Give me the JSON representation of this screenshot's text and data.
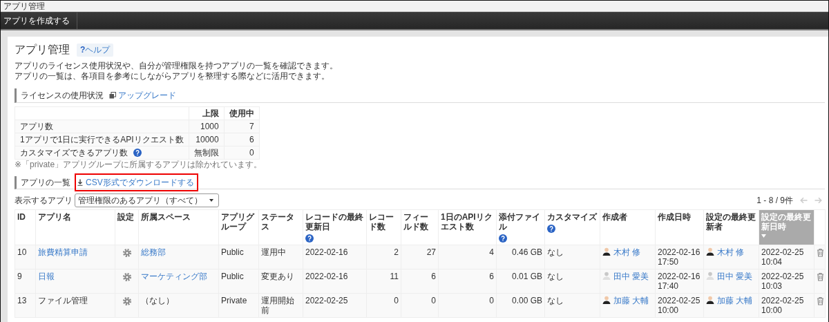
{
  "window": {
    "title": "アプリ管理"
  },
  "toolbar": {
    "buttons": [
      "アプリを作成する"
    ]
  },
  "page": {
    "title": "アプリ管理",
    "help_link": "**?**ヘルプ",
    "description": [
      "アプリのライセンス使用状況や、自分が管理権限を持つアプリの一覧を確認できます。",
      "アプリの一覧は、各項目を参考にしながらアプリを整理する際などに活用できます。"
    ]
  },
  "license": {
    "heading": "ライセンスの使用状況",
    "upgrade_link": "アップグレード",
    "columns": [
      "上限",
      "使用中"
    ],
    "rows": [
      {
        "label": "アプリ数",
        "help": false,
        "limit": "1000",
        "used": "7"
      },
      {
        "label": "1アプリで1日に実行できるAPIリクエスト数",
        "help": false,
        "limit": "10000",
        "used": "6"
      },
      {
        "label": "カスタマイズできるアプリ数",
        "help": true,
        "limit": "無制限",
        "used": "0"
      }
    ],
    "note": "※「private」アプリグループに所属するアプリは除かれています。"
  },
  "app_list": {
    "heading": "アプリの一覧",
    "csv_link": {
      "label": "CSV形式でダウンロードする",
      "highlighted": true
    },
    "filter": {
      "label": "表示するアプリ",
      "value": "管理権限のあるアプリ（すべて）"
    },
    "pagination": {
      "range": "1 - 8 / 9件",
      "prev_disabled": true,
      "next_disabled": true
    },
    "columns": [
      {
        "label": "ID",
        "kind": "text",
        "help": false,
        "sorted": false
      },
      {
        "label": "アプリ名",
        "kind": "link",
        "help": false,
        "sorted": false
      },
      {
        "label": "設定",
        "kind": "gear",
        "help": false,
        "sorted": false
      },
      {
        "label": "所属スペース",
        "kind": "link",
        "help": false,
        "sorted": false
      },
      {
        "label": "アプリグループ",
        "kind": "text",
        "help": false,
        "sorted": false
      },
      {
        "label": "ステータス",
        "kind": "text",
        "help": false,
        "sorted": false
      },
      {
        "label": "レコードの最終更新日",
        "kind": "text",
        "help": true,
        "sorted": false
      },
      {
        "label": "レコード数",
        "kind": "number",
        "help": false,
        "sorted": false
      },
      {
        "label": "フィールド数",
        "kind": "number",
        "help": false,
        "sorted": false
      },
      {
        "label": "1日のAPIリクエスト数",
        "kind": "number",
        "help": false,
        "sorted": false
      },
      {
        "label": "添付ファイル",
        "kind": "number",
        "help": true,
        "sorted": false
      },
      {
        "label": "カスタマイズ",
        "kind": "text",
        "help": true,
        "sorted": false
      },
      {
        "label": "作成者",
        "kind": "user",
        "help": false,
        "sorted": false
      },
      {
        "label": "作成日時",
        "kind": "text",
        "help": false,
        "sorted": false
      },
      {
        "label": "設定の最終更新者",
        "kind": "user",
        "help": false,
        "sorted": false
      },
      {
        "label": "設定の最終更新日時",
        "kind": "text",
        "help": false,
        "sorted": true
      },
      {
        "kind": "delete",
        "help": false,
        "sorted": false
      }
    ],
    "rows": [
      {
        "cells": [
          "10",
          {
            "text": "旅費精算申請",
            "link": true
          },
          "",
          {
            "text": "総務部",
            "link": true
          },
          "Public",
          "運用中",
          "2022-02-16",
          "2",
          "27",
          "4",
          "0.46 GB",
          "なし",
          {
            "name": "木村 修",
            "default_avatar": false
          },
          "2022-02-16 17:50",
          {
            "name": "木村 修",
            "default_avatar": false
          },
          "2022-02-25 10:04",
          ""
        ]
      },
      {
        "cells": [
          "9",
          {
            "text": "日報",
            "link": true
          },
          "",
          {
            "text": "マーケティング部",
            "link": true
          },
          "Public",
          "変更あり",
          "2022-02-16",
          "11",
          "6",
          "6",
          "0.01 GB",
          "なし",
          {
            "name": "田中 愛美",
            "default_avatar": true
          },
          "2022-02-16 17:40",
          {
            "name": "田中 愛美",
            "default_avatar": true
          },
          "2022-02-25 10:03",
          ""
        ]
      },
      {
        "cells": [
          "13",
          {
            "text": "ファイル管理",
            "link": false
          },
          "",
          {
            "text": "（なし）",
            "link": false
          },
          "Private",
          "運用開始前",
          "2022-02-25",
          "0",
          "0",
          "0",
          "0.00 GB",
          "なし",
          {
            "name": "加藤 大輔",
            "default_avatar": false
          },
          "2022-02-25 10:00",
          {
            "name": "加藤 大輔",
            "default_avatar": false
          },
          "2022-02-25 10:00",
          ""
        ]
      }
    ]
  }
}
